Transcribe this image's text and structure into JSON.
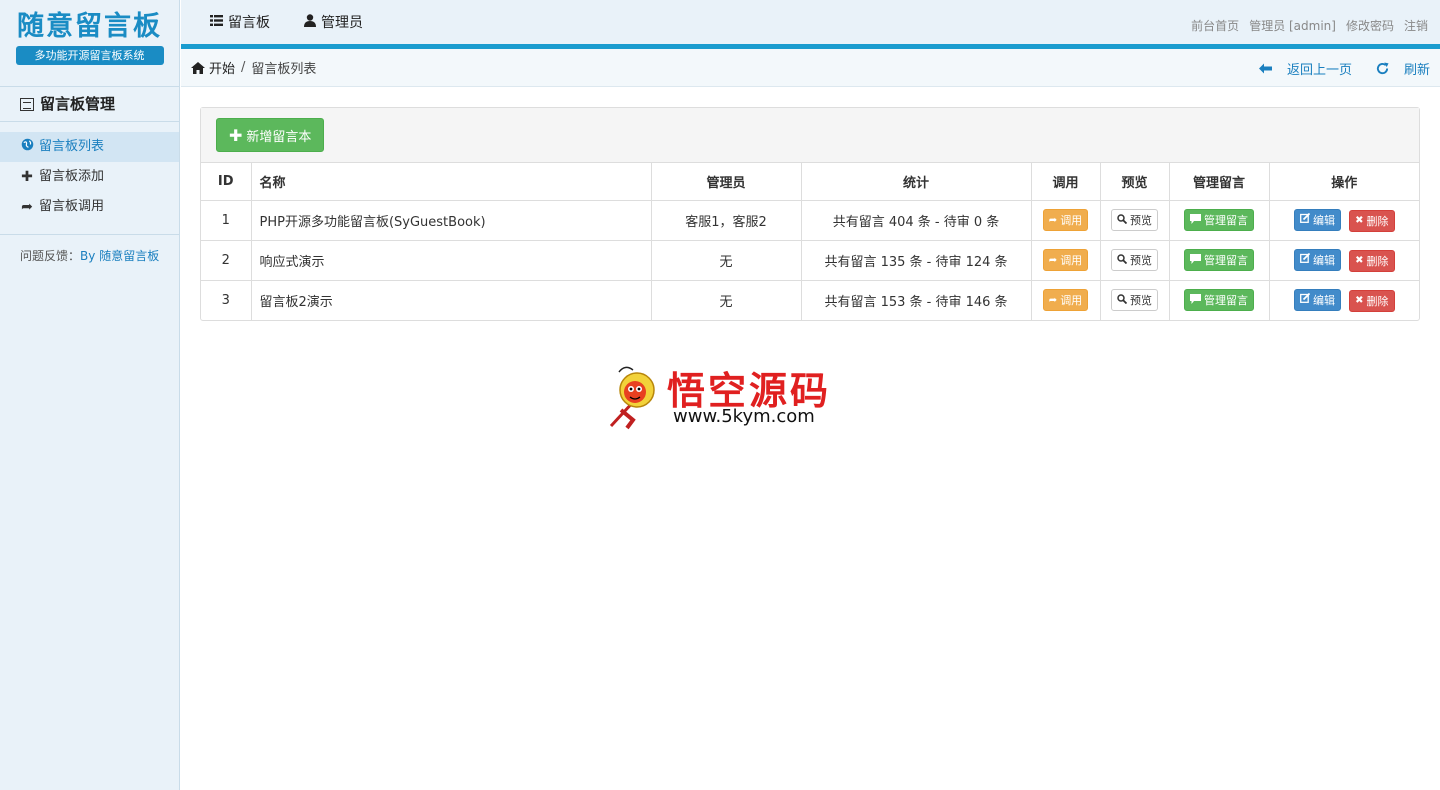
{
  "logo": {
    "title": "随意留言板",
    "subtitle": "多功能开源留言板系统"
  },
  "sidebar": {
    "heading": "留言板管理",
    "items": [
      {
        "label": "留言板列表",
        "icon": "globe-icon",
        "active": true
      },
      {
        "label": "留言板添加",
        "icon": "plus-icon",
        "active": false
      },
      {
        "label": "留言板调用",
        "icon": "share-icon",
        "active": false
      }
    ],
    "feedback_label": "问题反馈：",
    "feedback_by": "By",
    "feedback_link": "随意留言板"
  },
  "topnav": {
    "items": [
      {
        "label": "留言板",
        "icon": "list-icon"
      },
      {
        "label": "管理员",
        "icon": "user-icon"
      }
    ],
    "right": [
      "前台首页",
      "管理员 [admin]",
      "修改密码",
      "注销"
    ]
  },
  "breadcrumb": {
    "home": "开始",
    "separator": "/",
    "current": "留言板列表",
    "back": "返回上一页",
    "refresh": "刷新"
  },
  "panel": {
    "add_button": "新增留言本"
  },
  "table": {
    "headers": [
      "ID",
      "名称",
      "管理员",
      "统计",
      "调用",
      "预览",
      "管理留言",
      "操作"
    ],
    "rows": [
      {
        "id": "1",
        "name": "PHP开源多功能留言板(SyGuestBook)",
        "admins": "客服1，客服2",
        "stats": "共有留言 404 条 - 待审 0 条"
      },
      {
        "id": "2",
        "name": "响应式演示",
        "admins": "无",
        "stats": "共有留言 135 条 - 待审 124 条"
      },
      {
        "id": "3",
        "name": "留言板2演示",
        "admins": "无",
        "stats": "共有留言 153 条 - 待审 146 条"
      }
    ],
    "btn_call": "调用",
    "btn_preview": "预览",
    "btn_manage": "管理留言",
    "btn_edit": "编辑",
    "btn_delete": "删除"
  },
  "watermark": {
    "text": "悟空源码",
    "url": "www.5kym.com"
  },
  "colors": {
    "accent": "#1a9ccf",
    "sidebar_bg": "#e9f2f9",
    "link": "#1a7fbf",
    "success": "#5cb85c",
    "warning": "#f0ad4e",
    "primary": "#428bca",
    "danger": "#d9534f"
  }
}
